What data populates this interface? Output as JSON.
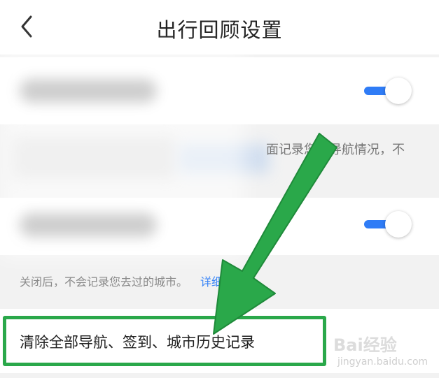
{
  "header": {
    "title": "出行回顾设置",
    "back_icon": "chevron-left-icon"
  },
  "settings": [
    {
      "name": "navigation-record",
      "enabled": true
    },
    {
      "name": "city-record",
      "enabled": true
    }
  ],
  "descriptions": {
    "navigation_partial": "面记录您的导航情况，不",
    "city_text": "关闭后，不会记录您去过的城市。",
    "city_link_partial": "详细说明>"
  },
  "clear_row": {
    "label": "清除全部导航、签到、城市历史记录"
  },
  "watermark": {
    "main": "Bai经验",
    "sub": "jingyan.baidu.com"
  },
  "colors": {
    "toggle_on": "#2f7cf6",
    "link": "#3b86f7",
    "highlight": "#2aa84a",
    "background": "#f2f2f2"
  }
}
